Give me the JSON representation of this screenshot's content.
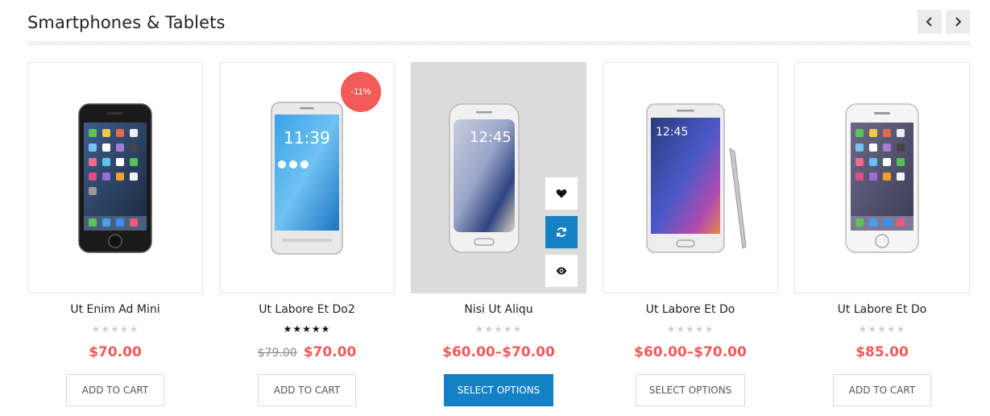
{
  "section": {
    "title": "Smartphones & Tablets",
    "prev_label": "previous",
    "next_label": "next"
  },
  "colors": {
    "accent": "#1581c5",
    "price": "#f35a5a",
    "sale_badge": "#f35a5a"
  },
  "products": [
    {
      "name": "Ut Enim Ad Mini",
      "rating": 0,
      "price": "$70.00",
      "button": "ADD TO CART",
      "image_icon": "dark-smartphone-icon"
    },
    {
      "name": "Ut Labore Et Do2",
      "rating": 5,
      "old_price": "$79.00",
      "price": "$70.00",
      "badge": "-11%",
      "button": "ADD TO CART",
      "image_icon": "silver-smartphone-icon"
    },
    {
      "name": "Nisi Ut Aliqu",
      "rating": 0,
      "price": "$60.00–$70.00",
      "button": "SELECT OPTIONS",
      "image_icon": "curved-smartphone-icon",
      "actions": [
        "heart-icon",
        "refresh-icon",
        "eye-icon"
      ]
    },
    {
      "name": "Ut Labore Et Do",
      "rating": 0,
      "price": "$60.00–$70.00",
      "button": "SELECT OPTIONS",
      "image_icon": "phablet-stylus-icon"
    },
    {
      "name": "Ut Labore Et Do",
      "rating": 0,
      "price": "$85.00",
      "button": "ADD TO CART",
      "image_icon": "white-smartphone-icon"
    }
  ]
}
